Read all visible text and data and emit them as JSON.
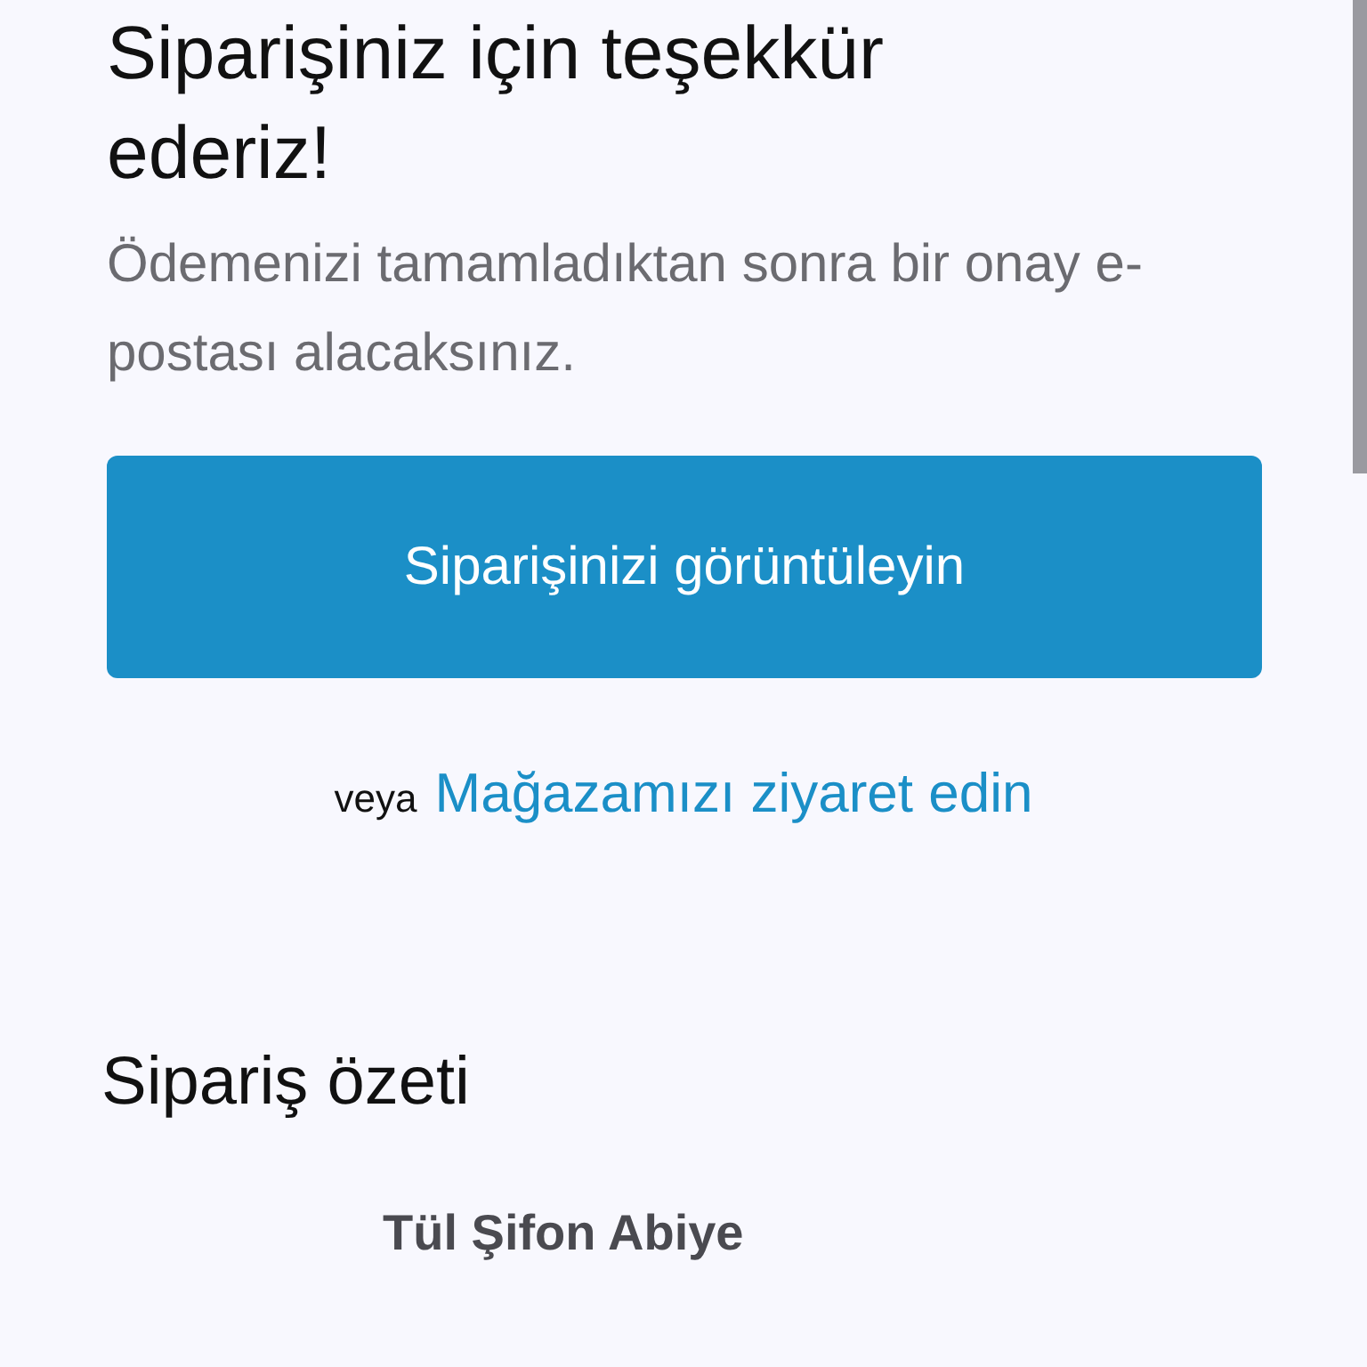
{
  "title": "Siparişiniz için teşekkür ederiz!",
  "subtitle": "Ödemenizi tamamladıktan sonra bir onay e-postası alacaksınız.",
  "view_order_button": "Siparişinizi görüntüleyin",
  "alternative": {
    "prefix": "veya",
    "link": "Mağazamızı ziyaret edin"
  },
  "summary": {
    "heading": "Sipariş özeti",
    "items": [
      {
        "name": "Tül Şifon Abiye"
      }
    ]
  }
}
